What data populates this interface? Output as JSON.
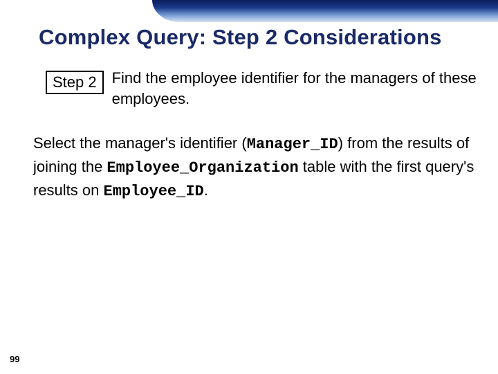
{
  "title": "Complex Query: Step 2 Considerations",
  "step": {
    "badge": "Step 2",
    "description": "Find the employee identifier for the managers of these employees."
  },
  "body": {
    "t1": "Select the manager's identifier (",
    "code1": "Manager_ID",
    "t2": ") from the results of joining the ",
    "code2": "Employee_Organization",
    "t3": " table with the first query's results on ",
    "code3": "Employee_ID",
    "t4": "."
  },
  "page_number": "99"
}
